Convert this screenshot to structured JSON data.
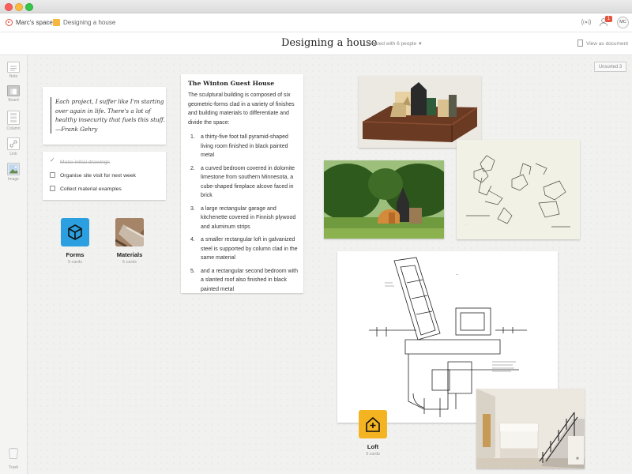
{
  "breadcrumb": {
    "space": "Marc's space",
    "board": "Designing a house"
  },
  "user": {
    "initials": "MC",
    "notifications": "1"
  },
  "board": {
    "title": "Designing a house",
    "shared": "Shared with 6 people",
    "view_as_document": "View as document",
    "unsorted": "Unsorted 3"
  },
  "toolbar": [
    {
      "label": "Note",
      "icon": "note-icon"
    },
    {
      "label": "Board",
      "icon": "board-icon"
    },
    {
      "label": "Column",
      "icon": "column-icon"
    },
    {
      "label": "Link",
      "icon": "link-icon"
    },
    {
      "label": "Image",
      "icon": "image-icon"
    }
  ],
  "trash": {
    "label": "Trash",
    "icon": "trash-icon"
  },
  "quote": {
    "text": "Each project, I suffer like I'm starting over again in life. There's a lot of healthy insecurity that fuels this stuff.",
    "author": "—Frank Gehry"
  },
  "todos": [
    {
      "text": "Make initial drawings",
      "done": true
    },
    {
      "text": "Organise site visit for next week",
      "done": false
    },
    {
      "text": "Collect material examples",
      "done": false
    }
  ],
  "boards": [
    {
      "name": "Forms",
      "count": "5 cards",
      "color": "#2b9fe0",
      "icon": "cube-icon"
    },
    {
      "name": "Materials",
      "count": "5 cards",
      "icon": "materials-thumbnail"
    },
    {
      "name": "Loft",
      "count": "3 cards",
      "color": "#f4b320",
      "icon": "house-plus-icon"
    }
  ],
  "text_card": {
    "title": "The Winton Guest House",
    "intro": "The sculptural building is composed of six geometric-forms clad in a variety of finishes and building materials to differentiate and divide the space:",
    "items": [
      {
        "num": "1.",
        "text": "a thirty-five foot tall pyramid-shaped living room finished in black painted metal"
      },
      {
        "num": "2.",
        "text": "a curved bedroom covered in dolomite limestone from southern Minnesota, a cube-shaped fireplace alcove faced in brick"
      },
      {
        "num": "3.",
        "text": "a large rectangular garage and kitchenette covered in Finnish plywood and aluminum strips"
      },
      {
        "num": "4.",
        "text": "a smaller rectangular loft in galvanized steel is supported by column clad in the same material"
      },
      {
        "num": "5.",
        "text": "and a rectangular second bedroom with a slanted roof also finished in black painted metal"
      }
    ]
  },
  "images": [
    {
      "name": "model-photo",
      "desc_icon": "architecture-model-image"
    },
    {
      "name": "house-photo",
      "desc_icon": "house-exterior-image"
    },
    {
      "name": "sketch-image",
      "desc_icon": "sketch-drawing-image"
    },
    {
      "name": "floorplan-image",
      "desc_icon": "floor-plan-image"
    },
    {
      "name": "interior-photo",
      "desc_icon": "interior-stairs-image"
    }
  ]
}
